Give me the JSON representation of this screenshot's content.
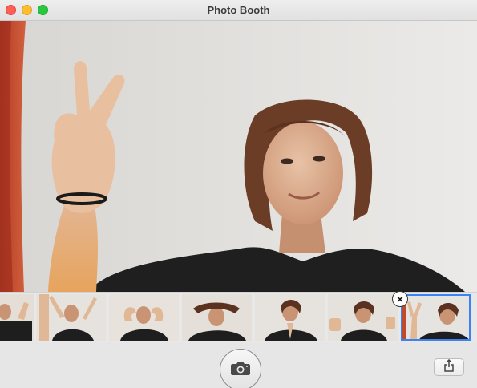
{
  "window": {
    "title": "Photo Booth"
  },
  "controls": {
    "close": "close-window",
    "minimize": "minimize-window",
    "zoom": "zoom-window"
  },
  "colors": {
    "close": "#fe5f57",
    "minimize": "#febc2e",
    "zoom": "#28c840",
    "selection": "#3b82f6"
  },
  "filmstrip": {
    "count": 7,
    "selected_index": 6,
    "delete_badge": "×"
  },
  "toolbar": {
    "shutter_icon": "camera-icon",
    "share_icon": "share-icon"
  }
}
